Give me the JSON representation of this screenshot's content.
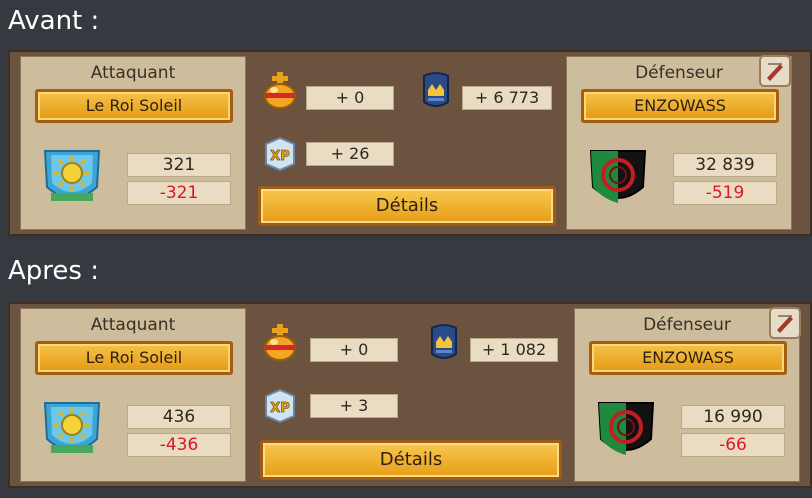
{
  "before": {
    "heading": "Avant :",
    "attacker": {
      "title": "Attaquant",
      "name": "Le Roi Soleil",
      "score": "321",
      "change": "-321"
    },
    "defender": {
      "title": "Défenseur",
      "name": "ENZOWASS",
      "score": "32 839",
      "change": "-519"
    },
    "orb": "+ 0",
    "xp": "+ 26",
    "guild": "+ 6 773",
    "details_label": "Détails"
  },
  "after": {
    "heading": "Apres :",
    "attacker": {
      "title": "Attaquant",
      "name": "Le Roi Soleil",
      "score": "436",
      "change": "-436"
    },
    "defender": {
      "title": "Défenseur",
      "name": "ENZOWASS",
      "score": "16 990",
      "change": "-66"
    },
    "orb": "+ 0",
    "xp": "+ 3",
    "guild": "+ 1 082",
    "details_label": "Détails"
  },
  "icons": {
    "attacker_emblem": "sun-shield-icon",
    "defender_emblem": "red-ring-shield-icon",
    "orb": "golden-orb-icon",
    "xp": "xp-box-icon",
    "guild": "guild-banner-icon",
    "corner": "scroll-icon"
  },
  "colors": {
    "negative": "#d8182a",
    "button": "#f0b030"
  }
}
